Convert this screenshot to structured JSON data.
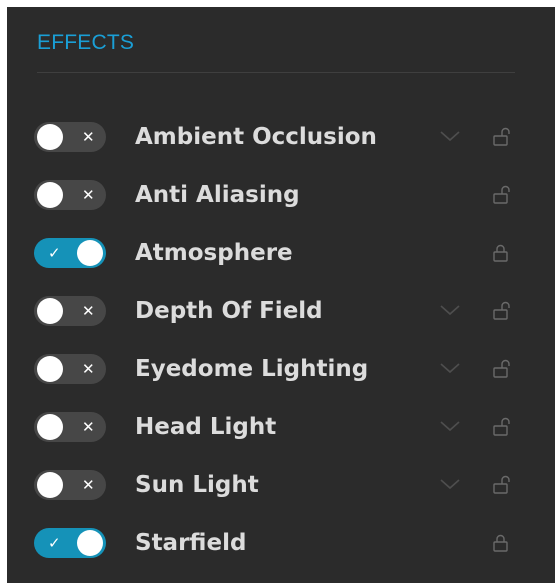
{
  "panel": {
    "title": "EFFECTS",
    "accent_color": "#1a9fd6",
    "toggle_on_color": "#1592b8"
  },
  "effects": [
    {
      "label": "Ambient Occlusion",
      "enabled": false,
      "toggle_mark": "✕",
      "expandable": true,
      "lock": "unlocked"
    },
    {
      "label": "Anti Aliasing",
      "enabled": false,
      "toggle_mark": "✕",
      "expandable": false,
      "lock": "unlocked"
    },
    {
      "label": "Atmosphere",
      "enabled": true,
      "toggle_mark": "✓",
      "expandable": false,
      "lock": "locked"
    },
    {
      "label": "Depth Of Field",
      "enabled": false,
      "toggle_mark": "✕",
      "expandable": true,
      "lock": "unlocked"
    },
    {
      "label": "Eyedome Lighting",
      "enabled": false,
      "toggle_mark": "✕",
      "expandable": true,
      "lock": "unlocked"
    },
    {
      "label": "Head Light",
      "enabled": false,
      "toggle_mark": "✕",
      "expandable": true,
      "lock": "unlocked"
    },
    {
      "label": "Sun Light",
      "enabled": false,
      "toggle_mark": "✕",
      "expandable": true,
      "lock": "unlocked"
    },
    {
      "label": "Starfield",
      "enabled": true,
      "toggle_mark": "✓",
      "expandable": false,
      "lock": "locked"
    }
  ]
}
